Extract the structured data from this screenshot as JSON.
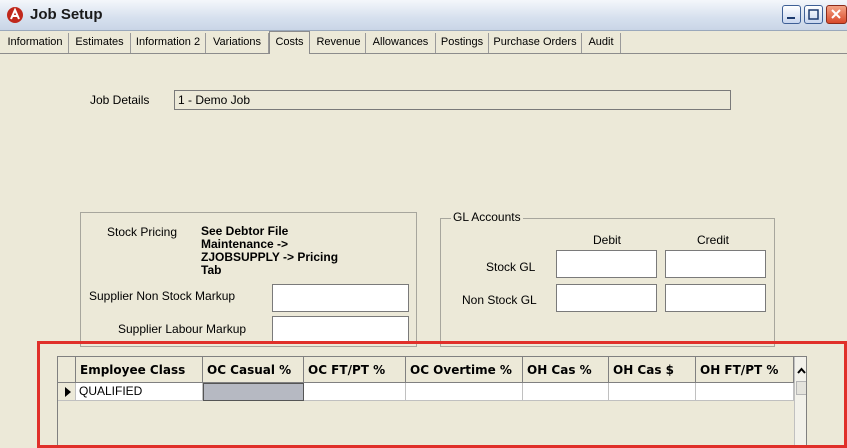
{
  "window": {
    "title": "Job Setup"
  },
  "tabs": [
    "Information",
    "Estimates",
    "Information 2",
    "Variations",
    "Costs",
    "Revenue",
    "Allowances",
    "Postings",
    "Purchase Orders",
    "Audit"
  ],
  "job_details": {
    "label": "Job Details",
    "value": "1 - Demo Job"
  },
  "stock_pricing": {
    "label": "Stock Pricing",
    "note_line1": "See Debtor File",
    "note_line2": "Maintenance ->",
    "note_line3": "ZJOBSUPPLY -> Pricing",
    "note_line4": "Tab"
  },
  "supplier_non_stock_markup": {
    "label": "Supplier Non Stock Markup",
    "value": ""
  },
  "supplier_labour_markup": {
    "label": "Supplier Labour Markup",
    "value": ""
  },
  "gl_accounts": {
    "legend": "GL Accounts",
    "debit_label": "Debit",
    "credit_label": "Credit",
    "stock_gl_label": "Stock GL",
    "non_stock_gl_label": "Non Stock GL"
  },
  "grid": {
    "columns": [
      "Employee Class",
      "OC Casual %",
      "OC FT/PT %",
      "OC Overtime %",
      "OH Cas %",
      "OH Cas $",
      "OH FT/PT %"
    ],
    "rows": [
      [
        "QUALIFIED",
        "",
        "",
        "",
        "",
        "",
        ""
      ]
    ]
  }
}
